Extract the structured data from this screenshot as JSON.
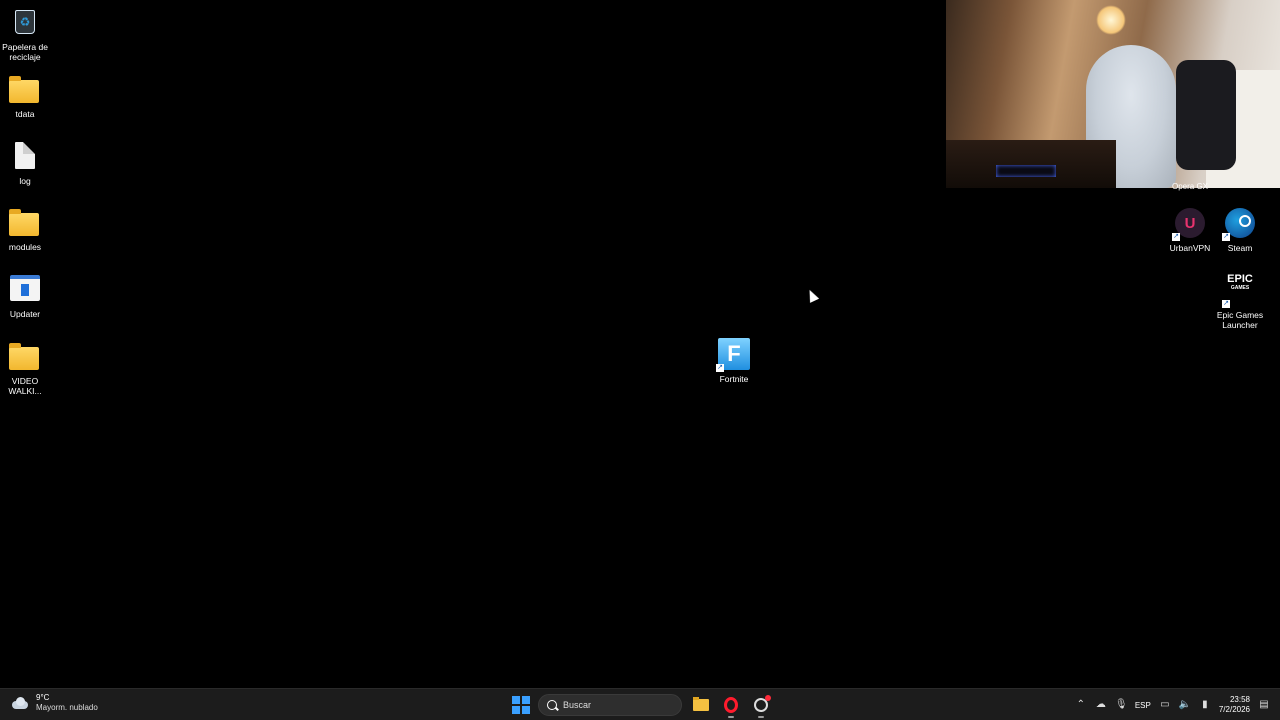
{
  "desktop": {
    "left_icons": [
      {
        "label": "Papelera de reciclaje",
        "icon": "recycle-bin-icon"
      },
      {
        "label": "tdata",
        "icon": "folder-icon"
      },
      {
        "label": "log",
        "icon": "text-file-icon"
      },
      {
        "label": "modules",
        "icon": "folder-icon"
      },
      {
        "label": "Updater",
        "icon": "updater-app-icon"
      },
      {
        "label": "VIDEO WALKI...",
        "icon": "folder-icon"
      }
    ],
    "fortnite": {
      "label": "Fortnite",
      "glyph": "F"
    },
    "opera_gx_label": "Opera GX",
    "urbanvpn": {
      "label": "UrbanVPN",
      "glyph": "U"
    },
    "steam": {
      "label": "Steam"
    },
    "epic": {
      "label": "Epic Games Launcher",
      "logo_top": "EPIC",
      "logo_bottom": "GAMES"
    }
  },
  "taskbar": {
    "weather": {
      "temp": "9°C",
      "desc": "Mayorm. nublado"
    },
    "search_placeholder": "Buscar",
    "language": "ESP",
    "time": "23:58",
    "date": "7/2/2026"
  },
  "colors": {
    "taskbar_bg": "#1c1c1c",
    "accent_blue": "#3aa0ff",
    "opera_red": "#ff1b2d"
  }
}
